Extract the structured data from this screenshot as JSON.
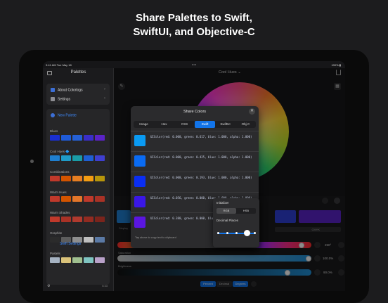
{
  "headline": {
    "line1": "Share Palettes to Swift,",
    "line2": "SwiftUI, and Objective-C"
  },
  "statusbar": {
    "time": "9:41 AM  Tue May 18",
    "dots": "•••",
    "battery": "100% ▮"
  },
  "sidebar": {
    "title": "Palettes",
    "menu": [
      {
        "label": "About Colorlogs",
        "chevron": "›"
      },
      {
        "label": "Settings",
        "chevron": "›"
      }
    ],
    "new_palette": "New Palette",
    "palettes": [
      {
        "name": "Blues",
        "colors": [
          "#1a2fd0",
          "#1f5bd8",
          "#2560d6",
          "#3a2ec9",
          "#5a23c6"
        ]
      },
      {
        "name": "Cool Hues 🔷",
        "colors": [
          "#1f7fd0",
          "#1f9bc8",
          "#1a9ca6",
          "#1f5fd4",
          "#3f3fd0"
        ]
      },
      {
        "name": "Combinations",
        "colors": [
          "#c0392b",
          "#d35400",
          "#e67e22",
          "#f39c12",
          "#b7950b"
        ]
      },
      {
        "name": "Warm Hues",
        "colors": [
          "#c0392b",
          "#d35400",
          "#e3762a",
          "#c0392b",
          "#a93226"
        ]
      },
      {
        "name": "Warm Shades",
        "colors": [
          "#c0392b",
          "#a93226",
          "#b03a2e",
          "#922b21",
          "#7b241c"
        ]
      },
      {
        "name": "Graphite",
        "colors": [
          "#2b2b2b",
          "#5d5d5d",
          "#8e8e8e",
          "#bfbfbf",
          "#5b7aa6"
        ]
      },
      {
        "name": "Pastels",
        "colors": [
          "#a6b3c2",
          "#d9c27a",
          "#9fbf8f",
          "#7fc4c1",
          "#b9a1c9"
        ]
      }
    ],
    "footer_time": "5:33"
  },
  "main": {
    "title": "Cool Hues ⌄",
    "eyedropper_icon": "eyedropper-icon",
    "grid_icon": "grid-icon",
    "hue_value": "250°",
    "saturation_label": "Saturation",
    "saturation_value": "100.0%",
    "brightness_label": "Brightness",
    "brightness_value": "90.0%",
    "display_label": "Display",
    "cmyk_label": "CMYK",
    "bottom_tabs": [
      "Percent",
      "Decimal",
      "Degrees"
    ]
  },
  "modal": {
    "title": "Share Colors",
    "close": "✕",
    "tabs": [
      "Image",
      "Hex",
      "CSS",
      "Swift",
      "SwiftUI",
      "Obj-C"
    ],
    "active_tab": "Swift",
    "rows": [
      {
        "color": "#0a9af2",
        "code": "UIColor(red: 0.000, green: 0.617, blue: 1.000, alpha: 1.000)"
      },
      {
        "color": "#0a6bf2",
        "code": "UIColor(red: 0.000, green: 0.425, blue: 1.000, alpha: 1.000)"
      },
      {
        "color": "#0a2ef2",
        "code": "UIColor(red: 0.000, green: 0.193, blue: 1.000, alpha: 1.000)"
      },
      {
        "color": "#3a17e6",
        "code": "UIColor(red: 0.056, green: 0.000, blue: 1.000, alpha: 1.000)"
      },
      {
        "color": "#5a16e0",
        "code": "UIColor(red: 0.380, green: 0.000, blue: 1.000, alpha: 1.000)"
      }
    ],
    "hint": "Tap above to copy text to clipboard"
  },
  "popover": {
    "initializer_label": "Initializer",
    "options": [
      "RGB",
      "HSB"
    ],
    "active_option": "RGB",
    "decimal_label": "Decimal Places",
    "decimal_scale": [
      "0",
      "",
      "",
      "",
      "4"
    ],
    "link": "Swift Settings"
  }
}
